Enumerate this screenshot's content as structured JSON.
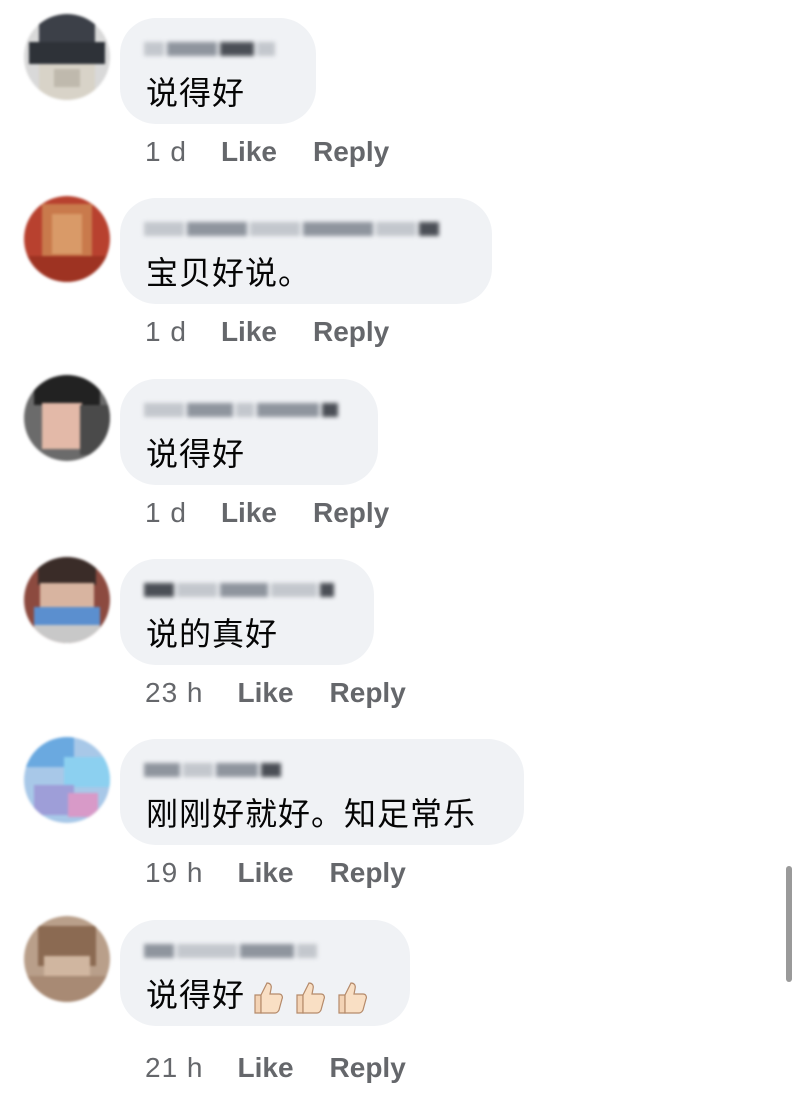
{
  "comments": [
    {
      "author": "blurred name",
      "text": "说得好",
      "time": "1 d",
      "like": "Like",
      "reply": "Reply"
    },
    {
      "author": "blurred name",
      "text": "宝贝好说。",
      "time": "1 d",
      "like": "Like",
      "reply": "Reply"
    },
    {
      "author": "blurred name",
      "text": "说得好",
      "time": "1 d",
      "like": "Like",
      "reply": "Reply"
    },
    {
      "author": "blurred name",
      "text": "说的真好",
      "time": "23 h",
      "like": "Like",
      "reply": "Reply"
    },
    {
      "author": "blurred name",
      "text": "刚刚好就好。知足常乐",
      "time": "19 h",
      "like": "Like",
      "reply": "Reply"
    },
    {
      "author": "blurred name",
      "text": "说得好",
      "emoji": "thumbs-up x3",
      "time": "21 h",
      "like": "Like",
      "reply": "Reply"
    }
  ],
  "colors": {
    "bubble_bg": "#f0f2f5",
    "meta_text": "#65676b",
    "comment_text": "#050505"
  }
}
